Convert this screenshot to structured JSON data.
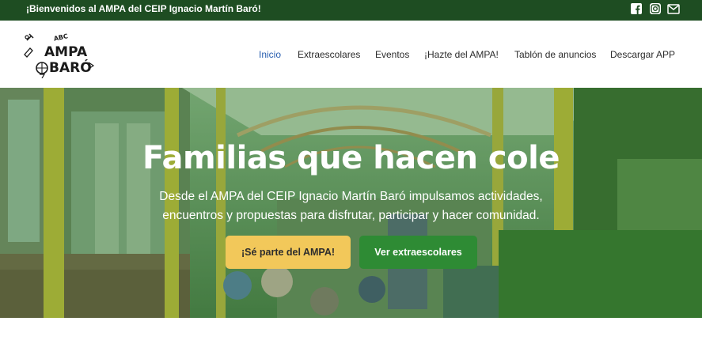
{
  "topbar": {
    "welcome_text": "¡Bienvenidos al AMPA del CEIP Ignacio Martín Baró!",
    "social": [
      "facebook-icon",
      "instagram-icon",
      "mail-icon"
    ]
  },
  "header": {
    "logo": {
      "line1": "AMPA",
      "line2": "BARÓ",
      "small": "ABC"
    },
    "nav": [
      {
        "label": "Inicio",
        "active": true
      },
      {
        "label": "Extraescolares",
        "active": false
      },
      {
        "label": "Eventos",
        "active": false
      },
      {
        "label": "¡Hazte del AMPA!",
        "active": false
      },
      {
        "label": "Tablón de anuncios",
        "active": false
      },
      {
        "label": "Descargar APP",
        "active": false
      }
    ]
  },
  "hero": {
    "title": "Familias que hacen cole",
    "subtitle_line1": "Desde el AMPA del CEIP Ignacio Martín Baró impulsamos actividades,",
    "subtitle_line2": "encuentros y propuestas para disfrutar, participar y hacer comunidad.",
    "primary_button": "¡Sé parte del AMPA!",
    "secondary_button": "Ver extraescolares"
  },
  "colors": {
    "topbar": "#1e4d22",
    "accent_yellow": "#f2c85a",
    "accent_green": "#2e8b34",
    "nav_active": "#2a5fb0"
  }
}
